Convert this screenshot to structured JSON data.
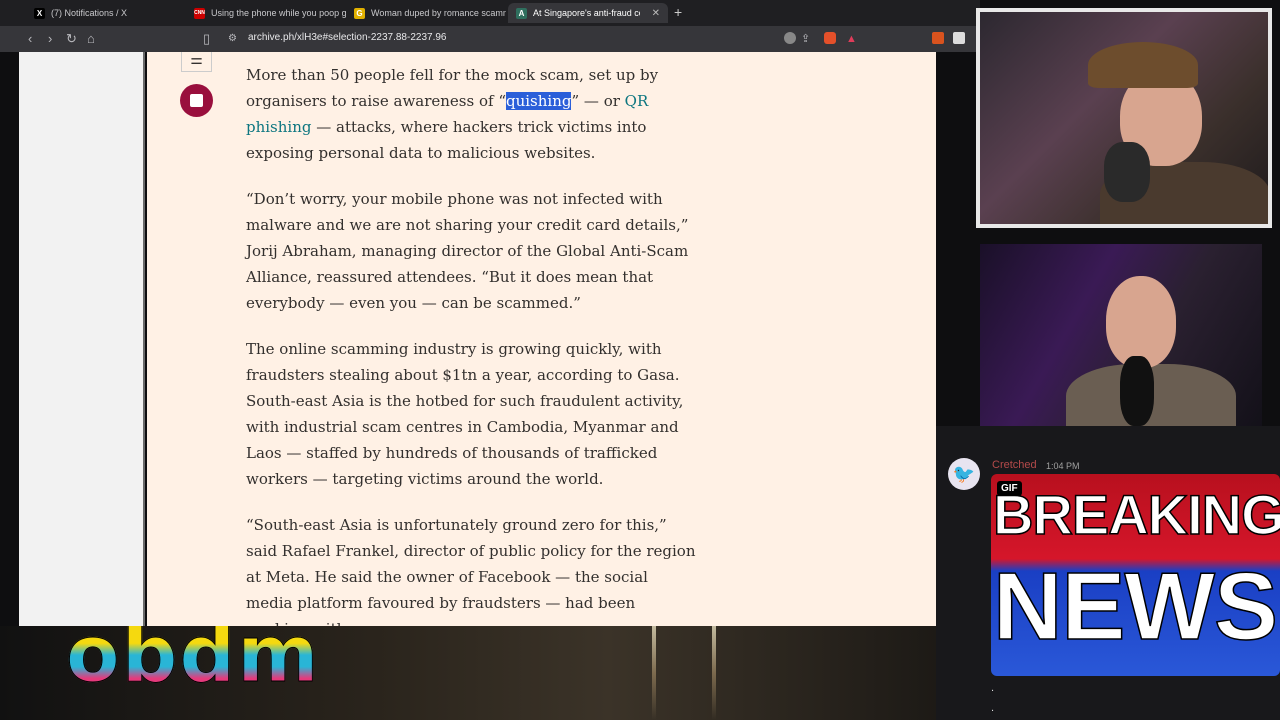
{
  "browser": {
    "tabs": [
      {
        "title": "(7) Notifications / X",
        "favicon": "X",
        "favicon_color": "#000000"
      },
      {
        "title": "Using the phone while you poop gre",
        "favicon": "CNN",
        "favicon_color": "#cc0000"
      },
      {
        "title": "Woman duped by romance scammer",
        "favicon": "G",
        "favicon_color": "#e0b000"
      },
      {
        "title": "At Singapore's anti-fraud conve",
        "favicon": "A",
        "favicon_color": "#2f6f5e",
        "active": true
      }
    ],
    "new_tab": "+",
    "url": "archive.ph/xlH3e#selection-2237.88-2237.96"
  },
  "article": {
    "p1_a": "More than 50 people fell for the mock scam, set up by organisers to raise awareness of “",
    "p1_highlight": "quishing",
    "p1_b": "” — or ",
    "p1_link": "QR phishing",
    "p1_c": " — attacks, where hackers trick victims into exposing personal data to malicious websites.",
    "p2": "“Don’t worry, your mobile phone was not infected with malware and we are not sharing your credit card details,” Jorij Abraham, managing director of the Global Anti-Scam Alliance, reassured attendees. “But it does mean that everybody — even you — can be scammed.”",
    "p3": "The online scamming industry is growing quickly, with fraudsters stealing about $1tn a year, according to Gasa. South-east Asia is the hotbed for such fraudulent activity, with industrial scam centres in Cambodia, Myanmar and Laos — staffed by hundreds of thousands of trafficked workers — targeting victims around the world.",
    "p4": "“South-east Asia is unfortunately ground zero for this,” said Rafael Frankel, director of public policy for the region at Meta. He said the owner of Facebook — the social media platform favoured by fraudsters — had been working with"
  },
  "overlay": {
    "logo": "obdm"
  },
  "chat": {
    "username": "Cretched",
    "time": "1:04 PM",
    "gif_badge": "GIF",
    "gif_line1": "BREAKING",
    "gif_line2": "NEWS",
    "dots": ".",
    "dots2": "."
  },
  "colors": {
    "page_bg": "#fff1e5",
    "highlight": "#2b5fd9",
    "link": "#0d7680",
    "stop_button": "#990f3d"
  }
}
